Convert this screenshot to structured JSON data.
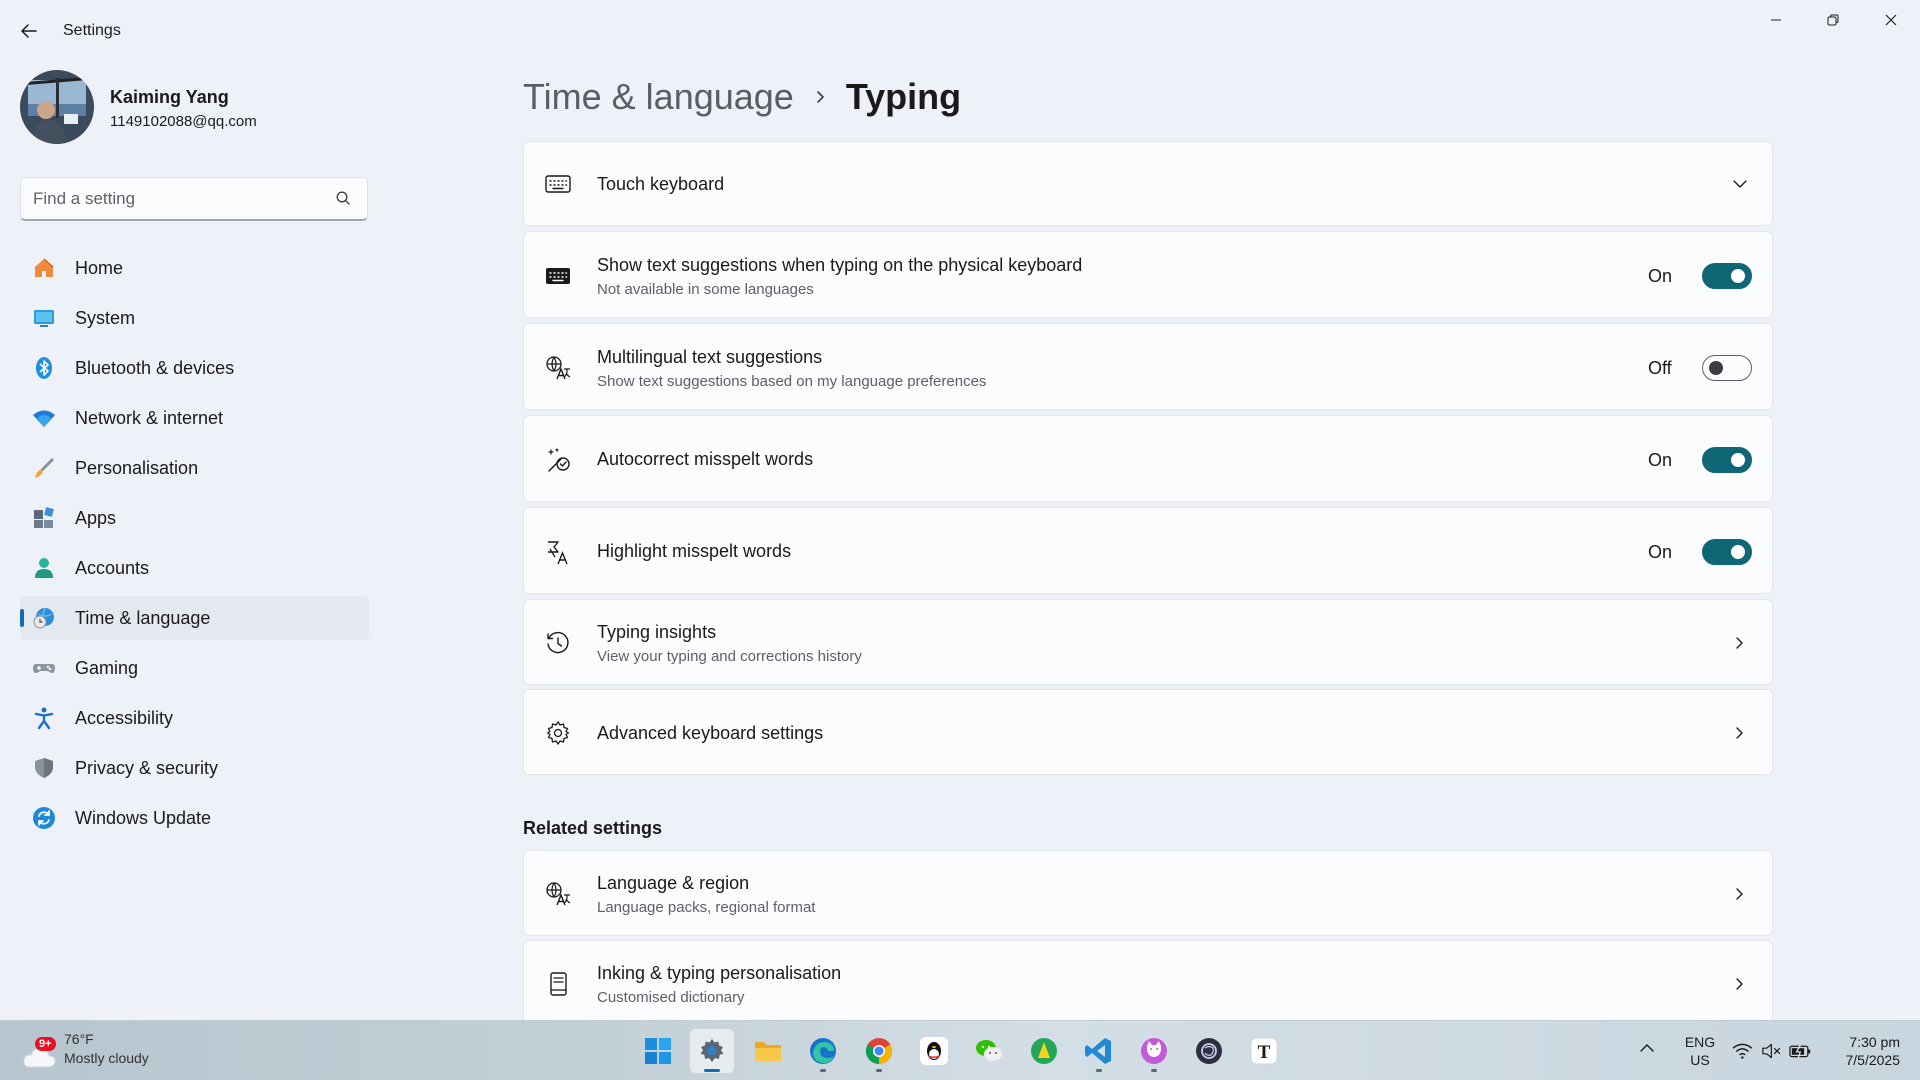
{
  "window": {
    "title": "Settings"
  },
  "profile": {
    "name": "Kaiming Yang",
    "email": "1149102088@qq.com"
  },
  "search": {
    "placeholder": "Find a setting"
  },
  "sidebar": {
    "items": [
      {
        "label": "Home",
        "icon": "home-icon"
      },
      {
        "label": "System",
        "icon": "system-icon"
      },
      {
        "label": "Bluetooth & devices",
        "icon": "bluetooth-icon"
      },
      {
        "label": "Network & internet",
        "icon": "wifi-icon"
      },
      {
        "label": "Personalisation",
        "icon": "brush-icon"
      },
      {
        "label": "Apps",
        "icon": "apps-icon"
      },
      {
        "label": "Accounts",
        "icon": "accounts-icon"
      },
      {
        "label": "Time & language",
        "icon": "time-language-icon",
        "active": true
      },
      {
        "label": "Gaming",
        "icon": "gamepad-icon"
      },
      {
        "label": "Accessibility",
        "icon": "accessibility-icon"
      },
      {
        "label": "Privacy & security",
        "icon": "shield-icon"
      },
      {
        "label": "Windows Update",
        "icon": "update-icon"
      }
    ]
  },
  "breadcrumb": {
    "parent": "Time & language",
    "current": "Typing"
  },
  "settings": {
    "touch_keyboard": {
      "title": "Touch keyboard"
    },
    "text_suggestions": {
      "title": "Show text suggestions when typing on the physical keyboard",
      "subtitle": "Not available in some languages",
      "state_label": "On",
      "on": true
    },
    "multilingual": {
      "title": "Multilingual text suggestions",
      "subtitle": "Show text suggestions based on my language preferences",
      "state_label": "Off",
      "on": false
    },
    "autocorrect": {
      "title": "Autocorrect misspelt words",
      "state_label": "On",
      "on": true
    },
    "highlight": {
      "title": "Highlight misspelt words",
      "state_label": "On",
      "on": true
    },
    "typing_insights": {
      "title": "Typing insights",
      "subtitle": "View your typing and corrections history"
    },
    "advanced_keyboard": {
      "title": "Advanced keyboard settings"
    }
  },
  "related": {
    "heading": "Related settings",
    "language_region": {
      "title": "Language & region",
      "subtitle": "Language packs, regional format"
    },
    "inking": {
      "title": "Inking & typing personalisation",
      "subtitle": "Customised dictionary"
    }
  },
  "taskbar": {
    "weather": {
      "temp": "76°F",
      "desc": "Mostly cloudy",
      "badge": "9+"
    },
    "apps": [
      "start-icon",
      "settings-icon",
      "file-explorer-icon",
      "edge-icon",
      "chrome-icon",
      "qq-icon",
      "wechat-icon",
      "app-icon",
      "vscode-icon",
      "cat-app-icon",
      "chatgpt-icon",
      "typora-icon"
    ],
    "typora_letter": "T",
    "lang_1": "ENG",
    "lang_2": "US",
    "time": "7:30 pm",
    "date": "7/5/2025"
  },
  "colors": {
    "accent": "#0f6cbd",
    "toggle_on": "#0f6775",
    "background": "#eef2f8",
    "card": "#fbfcfd"
  }
}
